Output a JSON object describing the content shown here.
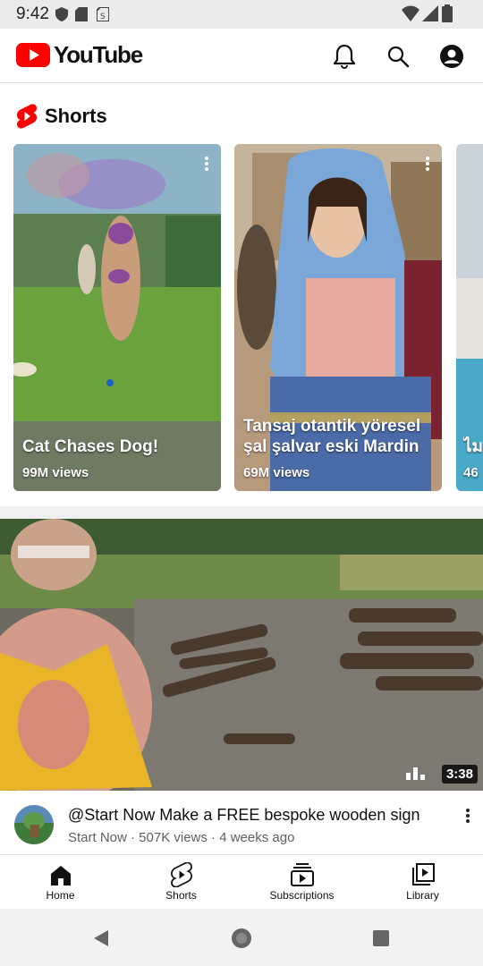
{
  "status_bar": {
    "time": "9:42"
  },
  "app_bar": {
    "logo_text": "YouTube",
    "brand_color": "#ff0000"
  },
  "shorts": {
    "section_title": "Shorts",
    "items": [
      {
        "title": "Cat Chases Dog!",
        "views": "99M views"
      },
      {
        "title": "Tansaj otantik yöresel şal şalvar eski Mardin",
        "views": "69M views"
      },
      {
        "title": "ไม",
        "views": "46"
      }
    ]
  },
  "video": {
    "duration": "3:38",
    "title": "@Start Now Make a FREE bespoke wooden sign",
    "meta": "Start Now · 507K views · 4 weeks ago"
  },
  "bottom_nav": [
    {
      "label": "Home",
      "icon": "home-icon",
      "active": true
    },
    {
      "label": "Shorts",
      "icon": "shorts-icon",
      "active": false
    },
    {
      "label": "Subscriptions",
      "icon": "subscriptions-icon",
      "active": false
    },
    {
      "label": "Library",
      "icon": "library-icon",
      "active": false
    }
  ]
}
